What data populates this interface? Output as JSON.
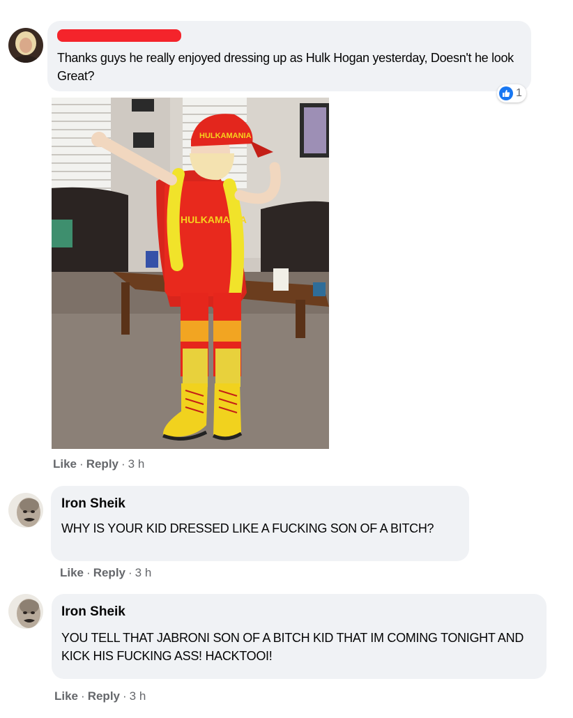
{
  "comments": [
    {
      "author": "",
      "text": "Thanks guys he really enjoyed dressing up as Hulk Hogan yesterday, Doesn't he look Great?",
      "reaction_count": "1",
      "actions": {
        "like": "Like",
        "reply": "Reply",
        "time": "3 h"
      }
    },
    {
      "author": "Iron Sheik",
      "text": "WHY IS YOUR KID DRESSED LIKE A FUCKING SON OF A BITCH?",
      "actions": {
        "like": "Like",
        "reply": "Reply",
        "time": "3 h"
      }
    },
    {
      "author": "Iron Sheik",
      "text": "YOU TELL THAT JABRONI SON OF A BITCH KID THAT IM COMING TONIGHT AND KICK HIS FUCKING ASS! HACKTOOI!",
      "actions": {
        "like": "Like",
        "reply": "Reply",
        "time": "3 h"
      }
    }
  ],
  "separator": "·",
  "icons": {
    "reaction": "thumbs-up-icon"
  },
  "colors": {
    "bubble": "#f0f2f5",
    "like_blue": "#1877f2",
    "redaction": "#f4242b",
    "meta_text": "#65676b"
  }
}
